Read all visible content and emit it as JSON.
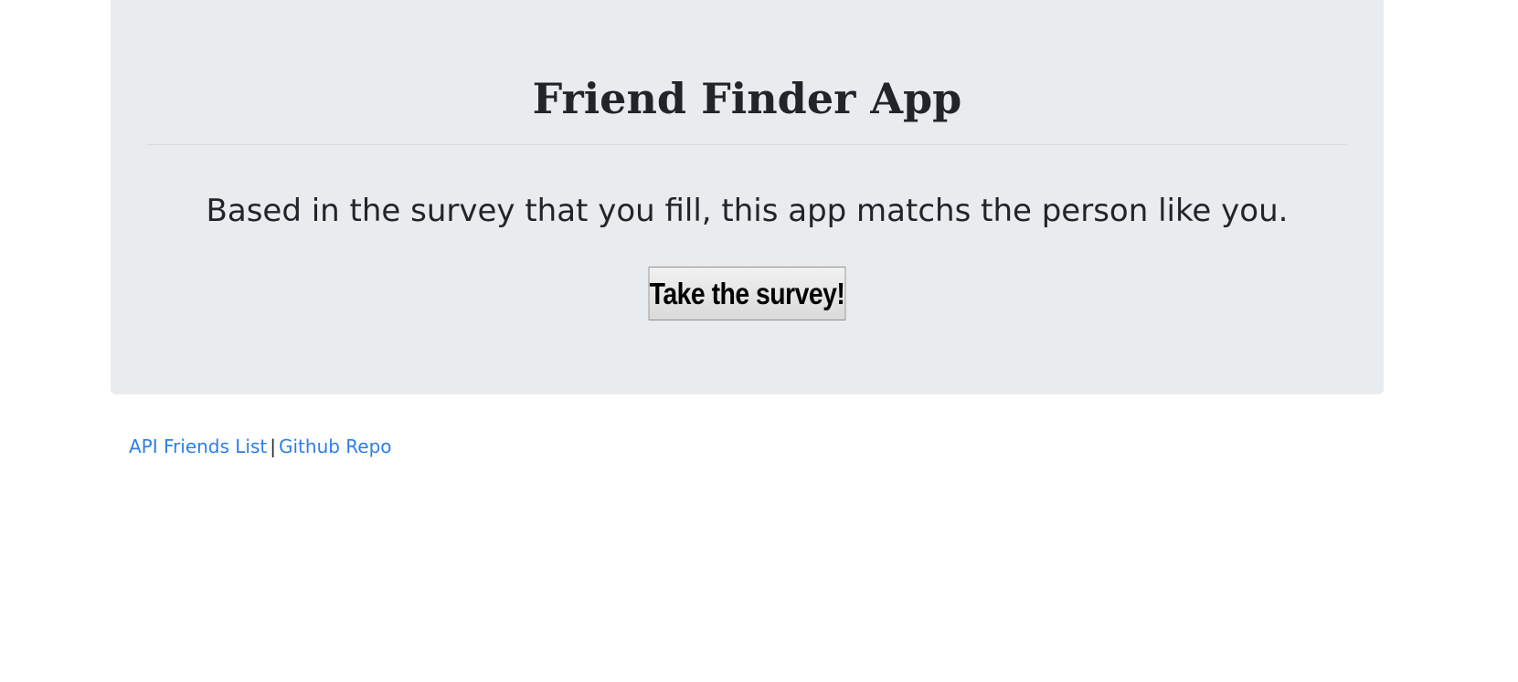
{
  "jumbotron": {
    "title": "Friend Finder App",
    "description": "Based in the survey that you fill, this app matchs the person like you.",
    "survey_button_label": "Take the survey!"
  },
  "footer": {
    "api_link_label": "API Friends List",
    "separator": "|",
    "github_link_label": "Github Repo"
  },
  "colors": {
    "jumbotron_bg": "#e9ecef",
    "text": "#212529",
    "link": "#2f7ee6"
  }
}
